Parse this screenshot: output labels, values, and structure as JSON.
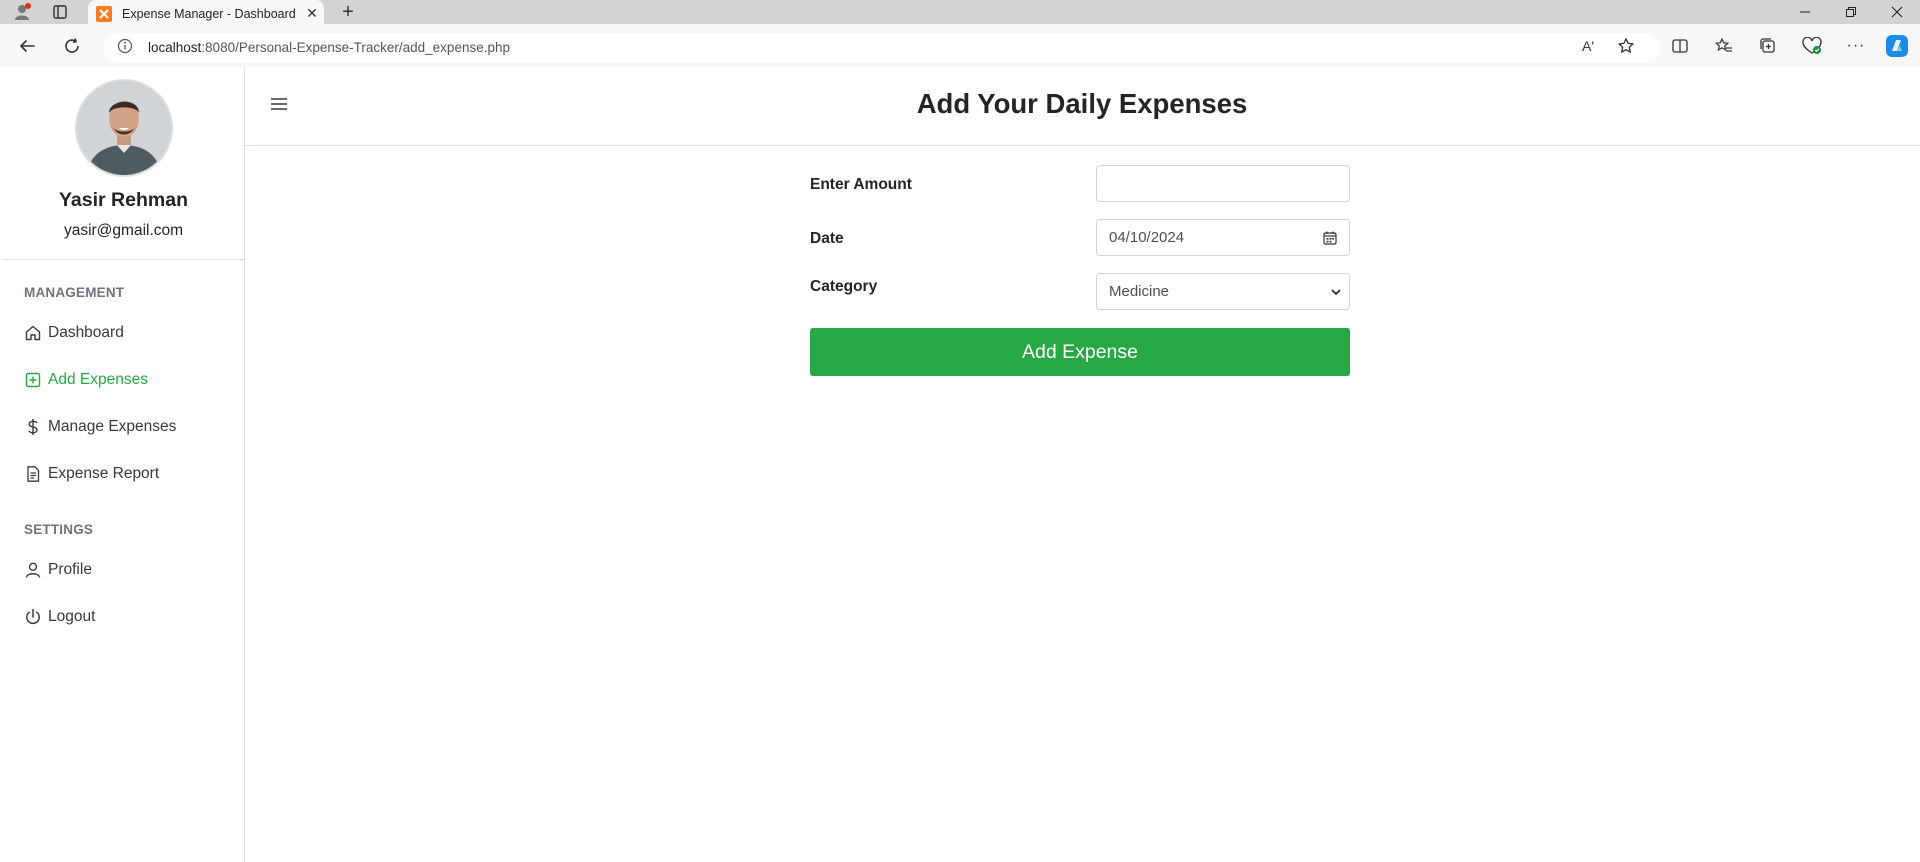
{
  "browser": {
    "tab_title": "Expense Manager - Dashboard",
    "url_host": "localhost",
    "url_rest": ":8080/Personal-Expense-Tracker/add_expense.php",
    "read_aloud_label": "Aʹ"
  },
  "sidebar": {
    "user_name": "Yasir Rehman",
    "user_email": "yasir@gmail.com",
    "section_management": "MANAGEMENT",
    "section_settings": "SETTINGS",
    "items": [
      {
        "label": "Dashboard",
        "icon": "home-icon",
        "active": false
      },
      {
        "label": "Add Expenses",
        "icon": "plus-square-icon",
        "active": true
      },
      {
        "label": "Manage Expenses",
        "icon": "dollar-icon",
        "active": false
      },
      {
        "label": "Expense Report",
        "icon": "document-icon",
        "active": false
      },
      {
        "label": "Profile",
        "icon": "user-icon",
        "active": false
      },
      {
        "label": "Logout",
        "icon": "power-icon",
        "active": false
      }
    ]
  },
  "main": {
    "title": "Add Your Daily Expenses",
    "form": {
      "amount_label": "Enter Amount",
      "amount_value": "",
      "date_label": "Date",
      "date_value": "04/10/2024",
      "category_label": "Category",
      "category_value": "Medicine",
      "submit_label": "Add Expense"
    }
  },
  "colors": {
    "accent_green": "#28a745",
    "border": "#dee2e6",
    "chrome_tabbar": "#d3d3d3",
    "chrome_toolbar": "#f7f7f7"
  }
}
